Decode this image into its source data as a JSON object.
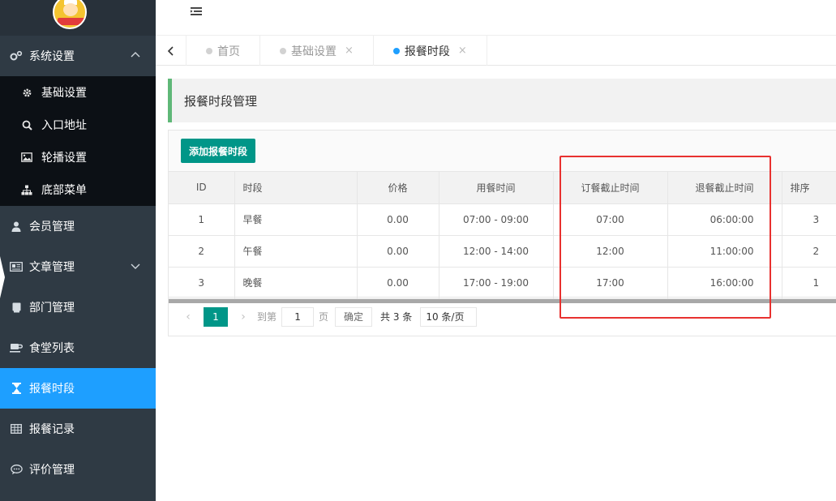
{
  "sidebar": {
    "group_system": {
      "label": "系统设置"
    },
    "sub_items": [
      {
        "label": "基础设置",
        "icon": "gear-icon"
      },
      {
        "label": "入口地址",
        "icon": "search-icon"
      },
      {
        "label": "轮播设置",
        "icon": "image-icon"
      },
      {
        "label": "底部菜单",
        "icon": "sitemap-icon"
      }
    ],
    "items": [
      {
        "label": "会员管理",
        "icon": "user-icon"
      },
      {
        "label": "文章管理",
        "icon": "news-icon"
      },
      {
        "label": "部门管理",
        "icon": "book-icon"
      },
      {
        "label": "食堂列表",
        "icon": "coffee-icon"
      },
      {
        "label": "报餐时段",
        "icon": "hourglass-icon"
      },
      {
        "label": "报餐记录",
        "icon": "table-icon"
      },
      {
        "label": "评价管理",
        "icon": "comment-icon"
      }
    ]
  },
  "tabs": [
    {
      "label": "首页"
    },
    {
      "label": "基础设置",
      "close": "×"
    },
    {
      "label": "报餐时段",
      "close": "×"
    }
  ],
  "page": {
    "title": "报餐时段管理",
    "add_button": "添加报餐时段"
  },
  "table": {
    "headers": [
      "ID",
      "时段",
      "价格",
      "用餐时间",
      "订餐截止时间",
      "退餐截止时间",
      "排序"
    ],
    "rows": [
      [
        "1",
        "早餐",
        "0.00",
        "07:00 - 09:00",
        "07:00",
        "06:00:00",
        "3"
      ],
      [
        "2",
        "午餐",
        "0.00",
        "12:00 - 14:00",
        "12:00",
        "11:00:00",
        "2"
      ],
      [
        "3",
        "晚餐",
        "0.00",
        "17:00 - 19:00",
        "17:00",
        "16:00:00",
        "1"
      ]
    ]
  },
  "pager": {
    "current": "1",
    "goto_label": "到第",
    "goto_value": "1",
    "page_label": "页",
    "confirm": "确定",
    "total": "共 3 条",
    "page_size": "10 条/页"
  },
  "colors": {
    "sidebar_bg": "#2f3a44",
    "active_blue": "#1e9fff",
    "primary_green": "#009688",
    "title_bar_accent": "#5fb878",
    "annotation_red": "#e8312f"
  }
}
